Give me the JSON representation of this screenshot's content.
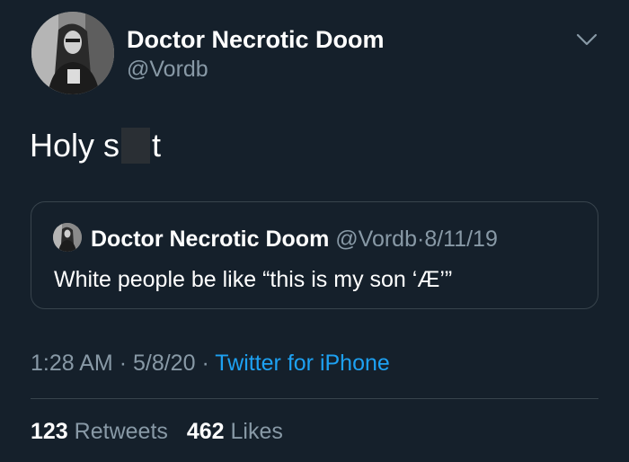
{
  "author": {
    "display_name": "Doctor Necrotic Doom",
    "handle": "@Vordb"
  },
  "tweet": {
    "text_before": "Holy s",
    "text_after": "t"
  },
  "quoted_tweet": {
    "display_name": "Doctor Necrotic Doom",
    "handle": "@Vordb",
    "separator": "·",
    "date": "8/11/19",
    "text": "White people be like “this is my son ‘Æ’”"
  },
  "meta": {
    "time": "1:28 AM",
    "separator": "·",
    "date": "5/8/20",
    "source": "Twitter for iPhone"
  },
  "stats": {
    "retweets_count": "123",
    "retweets_label": "Retweets",
    "likes_count": "462",
    "likes_label": "Likes"
  },
  "icons": {
    "menu": "chevron-down-icon"
  },
  "colors": {
    "background": "#15202b",
    "primary_text": "#ffffff",
    "secondary_text": "#8899a6",
    "link": "#1da1f2",
    "border": "#38444d"
  }
}
